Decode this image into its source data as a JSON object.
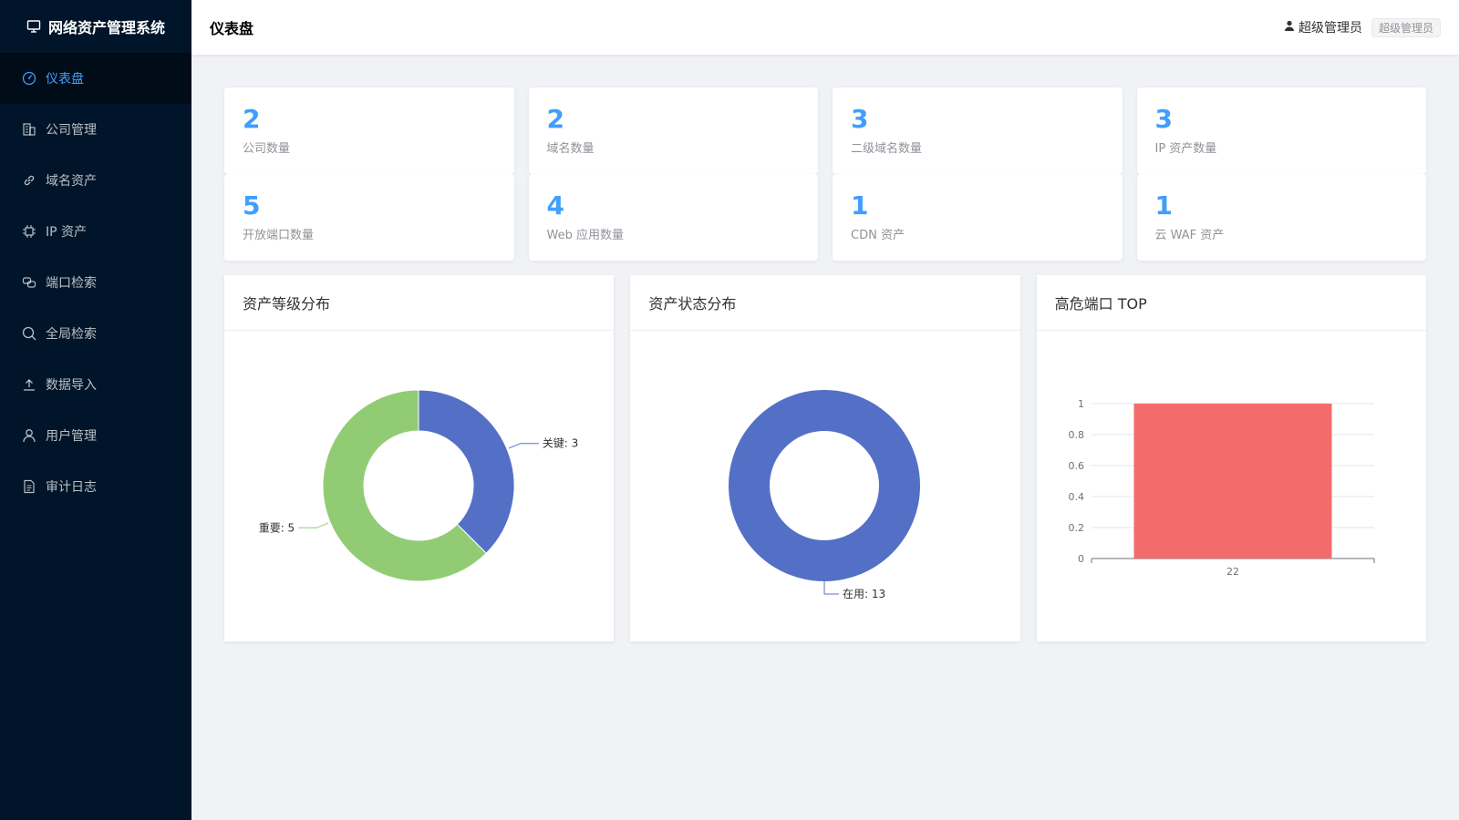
{
  "app": {
    "title": "网络资产管理系统",
    "logo_icon": "monitor-icon"
  },
  "sidebar": {
    "items": [
      {
        "label": "仪表盘",
        "icon": "dashboard-icon",
        "active": true
      },
      {
        "label": "公司管理",
        "icon": "building-icon"
      },
      {
        "label": "域名资产",
        "icon": "link-icon"
      },
      {
        "label": "IP 资产",
        "icon": "chip-icon"
      },
      {
        "label": "端口检索",
        "icon": "port-icon"
      },
      {
        "label": "全局检索",
        "icon": "search-icon"
      },
      {
        "label": "数据导入",
        "icon": "upload-icon"
      },
      {
        "label": "用户管理",
        "icon": "user-icon"
      },
      {
        "label": "审计日志",
        "icon": "document-icon"
      }
    ]
  },
  "header": {
    "title": "仪表盘",
    "user_name": "超级管理员",
    "user_role": "超级管理员"
  },
  "stats": [
    {
      "value": "2",
      "label": "公司数量"
    },
    {
      "value": "2",
      "label": "域名数量"
    },
    {
      "value": "3",
      "label": "二级域名数量"
    },
    {
      "value": "3",
      "label": "IP 资产数量"
    },
    {
      "value": "5",
      "label": "开放端口数量"
    },
    {
      "value": "4",
      "label": "Web 应用数量"
    },
    {
      "value": "1",
      "label": "CDN 资产"
    },
    {
      "value": "1",
      "label": "云 WAF 资产"
    }
  ],
  "charts": {
    "level": {
      "title": "资产等级分布"
    },
    "status": {
      "title": "资产状态分布"
    },
    "ports": {
      "title": "高危端口 TOP"
    }
  },
  "colors": {
    "accent": "#409eff",
    "sidebar_bg": "#001529",
    "blue": "#5470c6",
    "green": "#91cc75",
    "red": "#f46b6b"
  },
  "chart_data": [
    {
      "type": "pie",
      "title": "资产等级分布",
      "slices": [
        {
          "name": "关键",
          "value": 3,
          "label": "关键: 3",
          "color": "#5470c6"
        },
        {
          "name": "重要",
          "value": 5,
          "label": "重要: 5",
          "color": "#91cc75"
        }
      ],
      "donut": true
    },
    {
      "type": "pie",
      "title": "资产状态分布",
      "slices": [
        {
          "name": "在用",
          "value": 13,
          "label": "在用: 13",
          "color": "#5470c6"
        }
      ],
      "donut": true
    },
    {
      "type": "bar",
      "title": "高危端口 TOP",
      "categories": [
        "22"
      ],
      "values": [
        1
      ],
      "ylim": [
        0,
        1
      ],
      "yticks": [
        "0",
        "0.2",
        "0.4",
        "0.6",
        "0.8",
        "1"
      ],
      "color": "#f46b6b",
      "grid": true
    }
  ]
}
